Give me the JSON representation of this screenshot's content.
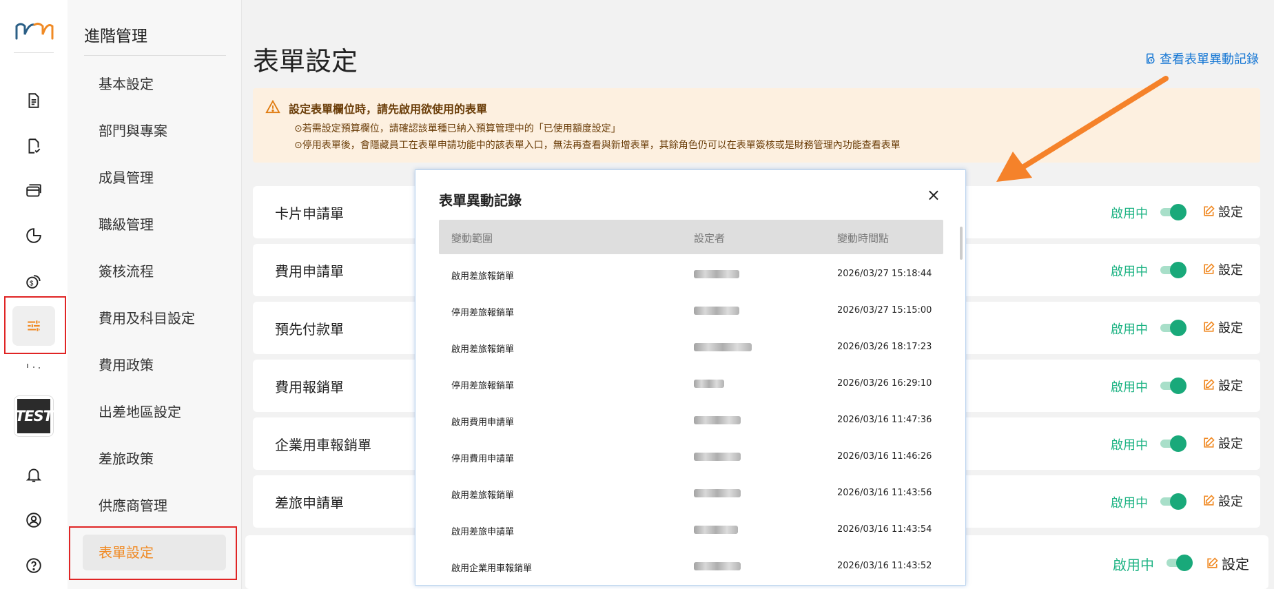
{
  "rail": {
    "logo_icon": "mm-logo",
    "avatar_text": "TEST",
    "icons": [
      "document-icon",
      "document-check-icon",
      "card-icon",
      "pie-chart-icon",
      "money-icon",
      "sliders-icon",
      "bell-icon",
      "user-circle-icon",
      "help-icon"
    ]
  },
  "subnav": {
    "title": "進階管理",
    "items": [
      "基本設定",
      "部門與專案",
      "成員管理",
      "職級管理",
      "簽核流程",
      "費用及科目設定",
      "費用政策",
      "出差地區設定",
      "差旅政策",
      "供應商管理",
      "表單設定"
    ],
    "active": "表單設定"
  },
  "main": {
    "title": "表單設定",
    "history_link": "查看表單異動記錄",
    "warning": {
      "title": "設定表單欄位時，請先啟用欲使用的表單",
      "lines": [
        "⊙若需設定預算欄位，請確認該單種已納入預算管理中的「已使用額度設定」",
        "⊙停用表單後，會隱藏員工在表單申請功能中的該表單入口，無法再查看與新增表單，其餘角色仍可以在表單簽核或是財務管理內功能查看表單"
      ]
    },
    "forms": [
      {
        "name": "卡片申請單",
        "status": "啟用中",
        "enabled": true,
        "action": "設定"
      },
      {
        "name": "費用申請單",
        "status": "啟用中",
        "enabled": true,
        "action": "設定"
      },
      {
        "name": "預先付款單",
        "status": "啟用中",
        "enabled": true,
        "action": "設定"
      },
      {
        "name": "費用報銷單",
        "status": "啟用中",
        "enabled": true,
        "action": "設定"
      },
      {
        "name": "企業用車報銷單",
        "status": "啟用中",
        "enabled": true,
        "action": "設定"
      },
      {
        "name": "差旅申請單",
        "status": "啟用中",
        "enabled": true,
        "action": "設定"
      }
    ],
    "bottom_row": {
      "status": "啟用中",
      "enabled": true,
      "action": "設定"
    }
  },
  "modal": {
    "title": "表單異動記錄",
    "close": "×",
    "columns": [
      "變動範圍",
      "設定者",
      "變動時間點"
    ],
    "rows": [
      {
        "scope": "啟用差旅報銷單",
        "time": "2026/03/27 15:18:44"
      },
      {
        "scope": "停用差旅報銷單",
        "time": "2026/03/27 15:15:00"
      },
      {
        "scope": "啟用差旅報銷單",
        "time": "2026/03/26 18:17:23"
      },
      {
        "scope": "停用差旅報銷單",
        "time": "2026/03/26 16:29:10"
      },
      {
        "scope": "啟用費用申請單",
        "time": "2026/03/16 11:47:36"
      },
      {
        "scope": "停用費用申請單",
        "time": "2026/03/16 11:46:26"
      },
      {
        "scope": "啟用差旅報銷單",
        "time": "2026/03/16 11:43:56"
      },
      {
        "scope": "啟用差旅申請單",
        "time": "2026/03/16 11:43:54"
      },
      {
        "scope": "啟用企業用車報銷單",
        "time": "2026/03/16 11:43:52"
      }
    ]
  },
  "colors": {
    "accent_orange": "#f08a24",
    "link_blue": "#1677d4",
    "status_green": "#1db383",
    "highlight_red": "#e02424",
    "warning_bg": "#fdf0e0"
  }
}
